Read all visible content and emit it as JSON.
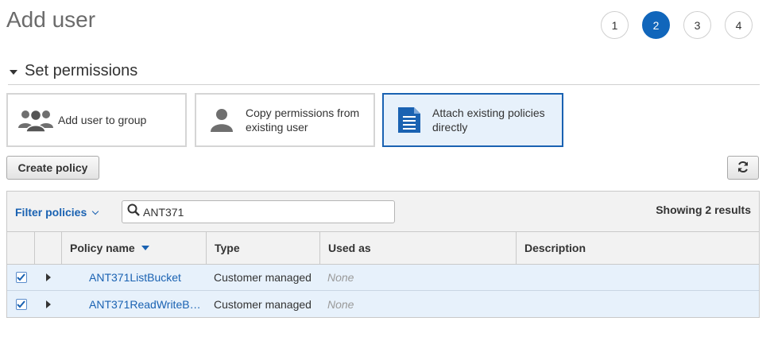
{
  "page": {
    "title": "Add user"
  },
  "steps": [
    {
      "label": "1",
      "active": false
    },
    {
      "label": "2",
      "active": true
    },
    {
      "label": "3",
      "active": false
    },
    {
      "label": "4",
      "active": false
    }
  ],
  "section": {
    "title": "Set permissions"
  },
  "options": [
    {
      "label": "Add user to group",
      "icon": "group-icon",
      "selected": false
    },
    {
      "label": "Copy permissions from existing user",
      "icon": "user-icon",
      "selected": false
    },
    {
      "label": "Attach existing policies directly",
      "icon": "document-icon",
      "selected": true
    }
  ],
  "toolbar": {
    "create_policy_label": "Create policy",
    "refresh_icon": "refresh-icon"
  },
  "filter": {
    "label": "Filter policies",
    "search_value": "ANT371",
    "results_text": "Showing 2 results"
  },
  "table": {
    "columns": [
      "Policy name",
      "Type",
      "Used as",
      "Description"
    ],
    "rows": [
      {
        "checked": true,
        "name": "ANT371ListBucket",
        "type": "Customer managed",
        "used_as": "None",
        "description": ""
      },
      {
        "checked": true,
        "name": "ANT371ReadWriteB…",
        "type": "Customer managed",
        "used_as": "None",
        "description": ""
      }
    ]
  },
  "colors": {
    "accent": "#1166bb",
    "selected_bg": "#e7f1fb",
    "link": "#1a62b2"
  }
}
